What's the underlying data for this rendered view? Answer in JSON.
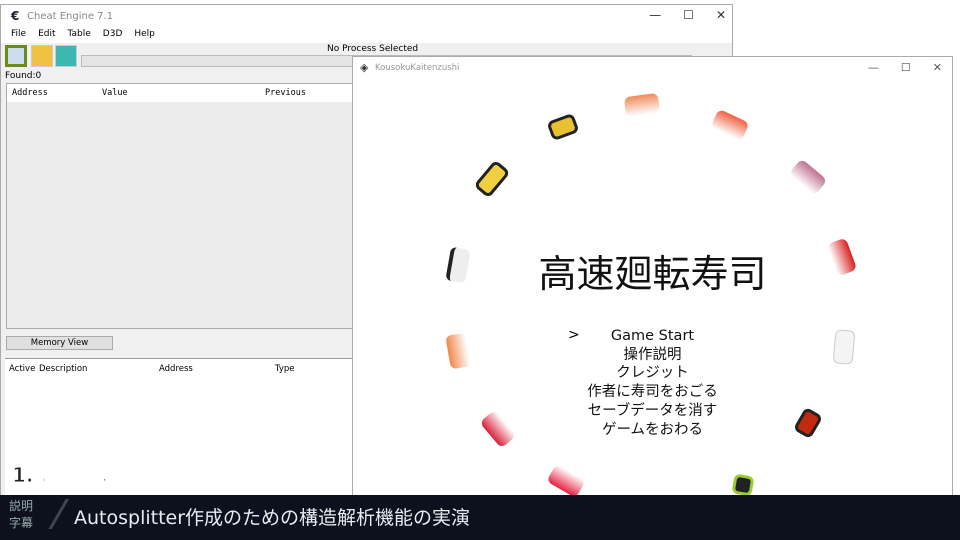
{
  "cheat_engine": {
    "title": "Cheat Engine 7.1",
    "menu": [
      "File",
      "Edit",
      "Table",
      "D3D",
      "Help"
    ],
    "process": "No Process Selected",
    "found": "Found:0",
    "columns": [
      "Address",
      "Value",
      "Previous"
    ],
    "memory_view": "Memory View",
    "table_columns": [
      "Active",
      "Description",
      "Address",
      "Type"
    ],
    "icons": [
      "open-process-icon",
      "open-file-icon",
      "save-icon"
    ]
  },
  "game": {
    "title": "KousokuKaitenzushi",
    "heading": "高速廻転寿司",
    "cursor": ">",
    "menu": [
      "Game Start",
      "操作説明",
      "クレジット",
      "作者に寿司をおごる",
      "セーブデータを消す",
      "ゲームをおわる"
    ]
  },
  "overlay": {
    "chapter": "1. はじめに",
    "label_line1": "説明",
    "label_line2": "字幕",
    "subtitle": "Autosplitter作成のための構造解析機能の実演"
  }
}
